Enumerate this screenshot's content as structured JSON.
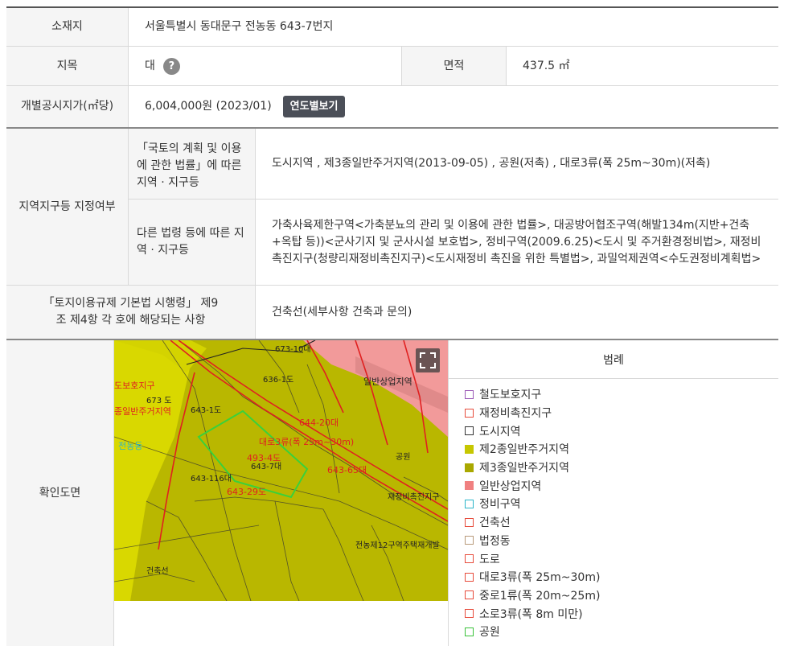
{
  "location": {
    "label": "소재지",
    "value": "서울특별시 동대문구 전농동 643-7번지"
  },
  "land_category": {
    "label": "지목",
    "value": "대",
    "help_icon": "?"
  },
  "area": {
    "label": "면적",
    "value": "437.5 ㎡"
  },
  "price": {
    "label": "개별공시지가(㎡당)",
    "value": "6,004,000원 (2023/01)",
    "button": "연도별보기"
  },
  "zoning": {
    "label": "지역지구등 지정여부",
    "national_label": "「국토의 계획 및 이용에 관한 법률」에 따른 지역 · 지구등",
    "national_value": "도시지역 , 제3종일반주거지역(2013-09-05) , 공원(저촉) , 대로3류(폭 25m~30m)(저촉)",
    "other_label": "다른 법령 등에 따른 지역 · 지구등",
    "other_value": "가축사육제한구역<가축분뇨의 관리 및 이용에 관한 법률>, 대공방어협조구역(해발134m(지반+건축+옥탑 등))<군사기지 및 군사시설 보호법>, 정비구역(2009.6.25)<도시 및 주거환경정비법>, 재정비촉진지구(청량리재정비촉진지구)<도시재정비 촉진을 위한 특별법>, 과밀억제권역<수도권정비계획법>"
  },
  "enforcement": {
    "label": "「토지이용규제 기본법 시행령」 제9조 제4항 각 호에 해당되는 사항",
    "value": "건축선(세부사항 건축과 문의)"
  },
  "map": {
    "label": "확인도면",
    "fullscreen_icon": "expand-icon",
    "labels": [
      "673-10대",
      "636-1도",
      "673 도",
      "643-1도",
      "643-116대",
      "643-7대",
      "공원",
      "재정비촉진지구",
      "전농제12구역주택재개발",
      "건축선",
      "대로3류(폭 25m~30m)",
      "493-4도",
      "643-29도",
      "643-65대",
      "644-20대",
      "일반상업지역",
      "종일반주거지역",
      "도보호지구",
      "전농동"
    ]
  },
  "legend": {
    "title": "범례",
    "items": [
      {
        "label": "철도보호지구",
        "color": "#9b59b6",
        "fill": ""
      },
      {
        "label": "재정비촉진지구",
        "color": "#e74c3c",
        "fill": ""
      },
      {
        "label": "도시지역",
        "color": "#333333",
        "fill": ""
      },
      {
        "label": "제2종일반주거지역",
        "color": "#c6c700",
        "fill": "#c6c700"
      },
      {
        "label": "제3종일반주거지역",
        "color": "#a9a800",
        "fill": "#a9a800"
      },
      {
        "label": "일반상업지역",
        "color": "#f08080",
        "fill": "#f08080"
      },
      {
        "label": "정비구역",
        "color": "#2bb5c9",
        "fill": ""
      },
      {
        "label": "건축선",
        "color": "#e74c3c",
        "fill": ""
      },
      {
        "label": "법정동",
        "color": "#b89a7a",
        "fill": ""
      },
      {
        "label": "도로",
        "color": "#e74c3c",
        "fill": ""
      },
      {
        "label": "대로3류(폭 25m~30m)",
        "color": "#e74c3c",
        "fill": ""
      },
      {
        "label": "중로1류(폭 20m~25m)",
        "color": "#e74c3c",
        "fill": ""
      },
      {
        "label": "소로3류(폭 8m 미만)",
        "color": "#e74c3c",
        "fill": ""
      },
      {
        "label": "공원",
        "color": "#3ac23a",
        "fill": ""
      }
    ]
  }
}
